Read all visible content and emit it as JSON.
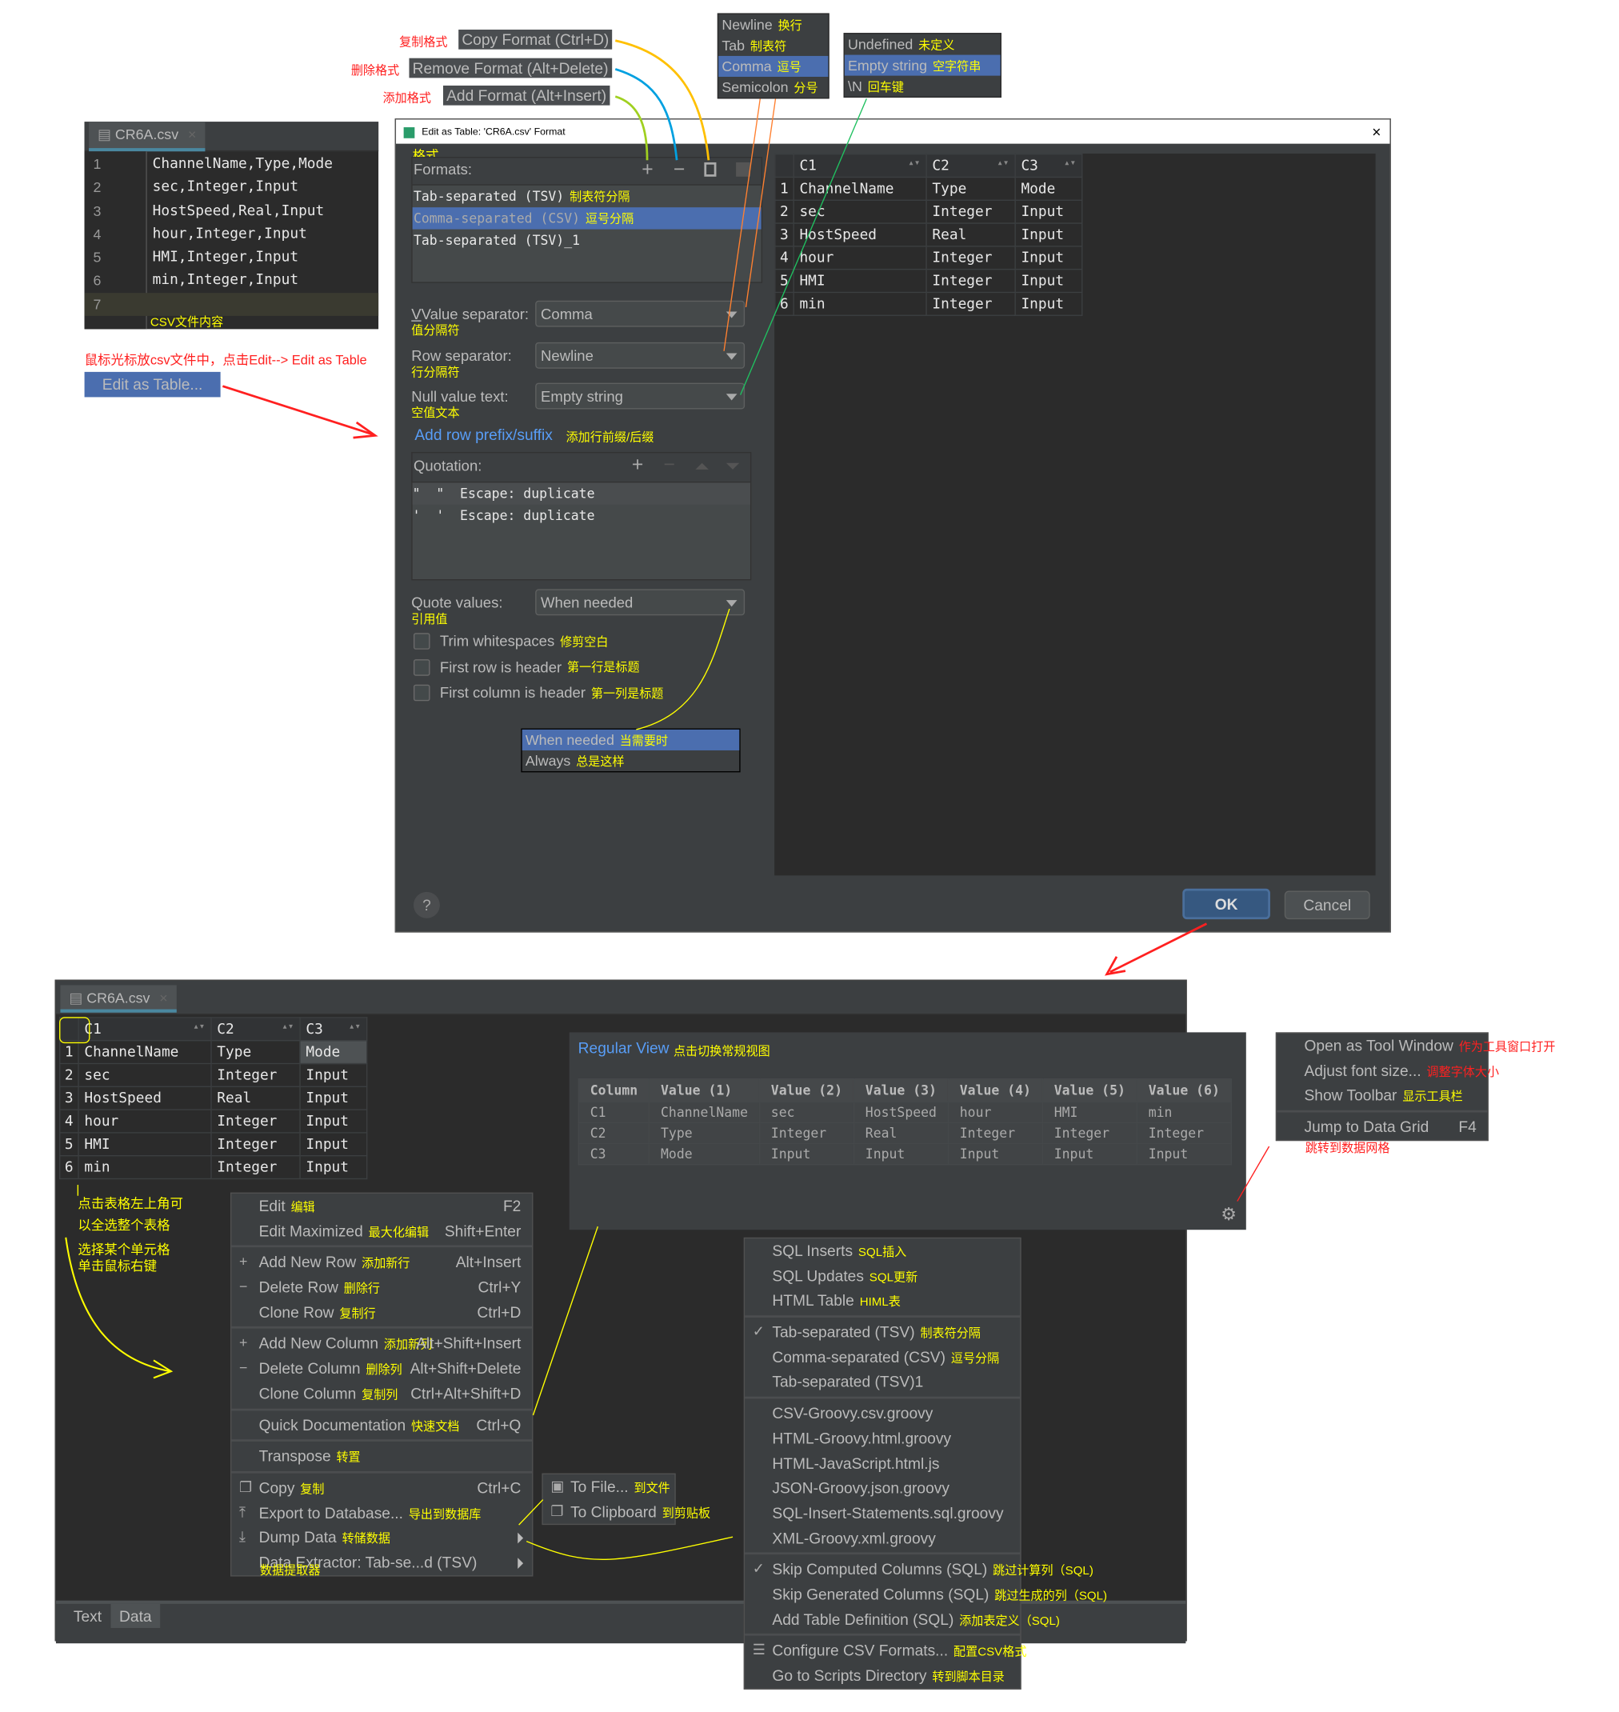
{
  "annotations": {
    "copy_format_cn": "复制格式",
    "remove_format_cn": "删除格式",
    "add_format_cn": "添加格式",
    "csv_content_cn": "CSV文件内容",
    "instruction_cn": "鼠标光标放csv文件中，点击Edit--> Edit as Table",
    "select_all_hint_1": "点击表格左上角可",
    "select_all_hint_2": "以全选整个表格",
    "right_click_hint_1": "选择某个单元格",
    "right_click_hint_2": "单击鼠标右键"
  },
  "tooltips": {
    "copy_format": "Copy Format (Ctrl+D)",
    "remove_format": "Remove Format (Alt+Delete)",
    "add_format": "Add Format (Alt+Insert)"
  },
  "row_separator_popup": [
    {
      "label": "Newline",
      "cn": "换行",
      "selected": false
    },
    {
      "label": "Tab",
      "cn": "制表符",
      "selected": false
    },
    {
      "label": "Comma",
      "cn": "逗号",
      "selected": true
    },
    {
      "label": "Semicolon",
      "cn": "分号",
      "selected": false
    }
  ],
  "null_value_popup": [
    {
      "label": "Undefined",
      "cn": "未定义",
      "selected": false
    },
    {
      "label": "Empty string",
      "cn": "空字符串",
      "selected": true
    },
    {
      "label": "\\N",
      "cn": "回车键",
      "selected": false
    }
  ],
  "editor_top": {
    "tab_label": "CR6A.csv",
    "lines": [
      {
        "n": "1",
        "text": "ChannelName,Type,Mode"
      },
      {
        "n": "2",
        "text": "sec,Integer,Input"
      },
      {
        "n": "3",
        "text": "HostSpeed,Real,Input"
      },
      {
        "n": "4",
        "text": "hour,Integer,Input"
      },
      {
        "n": "5",
        "text": "HMI,Integer,Input"
      },
      {
        "n": "6",
        "text": "min,Integer,Input"
      },
      {
        "n": "7",
        "text": ""
      }
    ]
  },
  "edit_as_table_menu_item": "Edit as Table...",
  "dialog": {
    "title": "Edit as Table: 'CR6A.csv' Format",
    "formats_cn": "格式",
    "formats_label": "Formats:",
    "formats": [
      {
        "label": "Tab-separated (TSV)",
        "cn": "制表符分隔",
        "selected": false
      },
      {
        "label": "Comma-separated (CSV)",
        "cn": "逗号分隔",
        "selected": true
      },
      {
        "label": "Tab-separated (TSV)_1",
        "cn": "",
        "selected": false
      }
    ],
    "value_separator_label": "Value separator:",
    "value_separator_cn": "值分隔符",
    "value_separator": "Comma",
    "row_separator_label": "Row separator:",
    "row_separator_cn": "行分隔符",
    "row_separator": "Newline",
    "null_value_label": "Null value text:",
    "null_value_cn": "空值文本",
    "null_value": "Empty string",
    "add_prefix_link": "Add row prefix/suffix",
    "add_prefix_cn": "添加行前缀/后缀",
    "quotation_label": "Quotation:",
    "quotations": [
      {
        "open": "\"",
        "close": "\"",
        "escape": "Escape: duplicate"
      },
      {
        "open": "'",
        "close": "'",
        "escape": "Escape: duplicate"
      }
    ],
    "quote_values_label": "Quote values:",
    "quote_values_cn": "引用值",
    "quote_values": "When needed",
    "checkboxes": [
      {
        "label": "Trim whitespaces",
        "cn": "修剪空白",
        "checked": false
      },
      {
        "label": "First row is header",
        "cn": "第一行是标题",
        "checked": false
      },
      {
        "label": "First column is header",
        "cn": "第一列是标题",
        "checked": false
      }
    ],
    "quote_popup": [
      {
        "label": "When needed",
        "cn": "当需要时",
        "selected": true
      },
      {
        "label": "Always",
        "cn": "总是这样",
        "selected": false
      }
    ],
    "preview": {
      "columns": [
        "C1",
        "C2",
        "C3"
      ],
      "rows": [
        [
          "1",
          "ChannelName",
          "Type",
          "Mode"
        ],
        [
          "2",
          "sec",
          "Integer",
          "Input"
        ],
        [
          "3",
          "HostSpeed",
          "Real",
          "Input"
        ],
        [
          "4",
          "hour",
          "Integer",
          "Input"
        ],
        [
          "5",
          "HMI",
          "Integer",
          "Input"
        ],
        [
          "6",
          "min",
          "Integer",
          "Input"
        ]
      ]
    },
    "help_label": "?",
    "ok_label": "OK",
    "cancel_label": "Cancel"
  },
  "editor_bottom": {
    "tab_label": "CR6A.csv",
    "columns": [
      "C1",
      "C2",
      "C3"
    ],
    "rows": [
      [
        "1",
        "ChannelName",
        "Type",
        "Mode"
      ],
      [
        "2",
        "sec",
        "Integer",
        "Input"
      ],
      [
        "3",
        "HostSpeed",
        "Real",
        "Input"
      ],
      [
        "4",
        "hour",
        "Integer",
        "Input"
      ],
      [
        "5",
        "HMI",
        "Integer",
        "Input"
      ],
      [
        "6",
        "min",
        "Integer",
        "Input"
      ]
    ],
    "bottom_tabs": [
      "Text",
      "Data"
    ]
  },
  "context_menu": {
    "groups": [
      [
        {
          "icon": "",
          "label": "Edit",
          "cn": "编辑",
          "shortcut": "F2"
        },
        {
          "icon": "",
          "label": "Edit Maximized",
          "cn": "最大化编辑",
          "shortcut": "Shift+Enter"
        }
      ],
      [
        {
          "icon": "plus",
          "label": "Add New Row",
          "cn": "添加新行",
          "shortcut": "Alt+Insert"
        },
        {
          "icon": "minus",
          "label": "Delete Row",
          "cn": "删除行",
          "shortcut": "Ctrl+Y"
        },
        {
          "icon": "",
          "label": "Clone Row",
          "cn": "复制行",
          "shortcut": "Ctrl+D"
        }
      ],
      [
        {
          "icon": "plus",
          "label": "Add New Column",
          "cn": "添加新列",
          "shortcut": "Alt+Shift+Insert"
        },
        {
          "icon": "minus",
          "label": "Delete Column",
          "cn": "删除列",
          "shortcut": "Alt+Shift+Delete"
        },
        {
          "icon": "",
          "label": "Clone Column",
          "cn": "复制列",
          "shortcut": "Ctrl+Alt+Shift+D"
        }
      ],
      [
        {
          "icon": "",
          "label": "Quick Documentation",
          "cn": "快速文档",
          "shortcut": "Ctrl+Q"
        }
      ],
      [
        {
          "icon": "",
          "label": "Transpose",
          "cn": "转置",
          "shortcut": ""
        }
      ],
      [
        {
          "icon": "copy",
          "label": "Copy",
          "cn": "复制",
          "shortcut": "Ctrl+C"
        },
        {
          "icon": "export",
          "label": "Export to Database...",
          "cn": "导出到数据库",
          "shortcut": ""
        },
        {
          "icon": "download",
          "label": "Dump Data",
          "cn": "转储数据",
          "shortcut": "",
          "submenu": true
        },
        {
          "icon": "",
          "label": "Data Extractor: Tab-se...d (TSV)",
          "cn": "",
          "shortcut": "",
          "submenu": true
        }
      ]
    ],
    "data_extractor_cn": "数据提取器"
  },
  "dump_submenu": [
    {
      "icon": "save",
      "label": "To File...",
      "cn": "到文件"
    },
    {
      "icon": "copy",
      "label": "To Clipboard",
      "cn": "到剪贴板"
    }
  ],
  "transposed_view": {
    "toggle_link": "Regular View",
    "toggle_cn": "点击切换常规视图",
    "headers": [
      "Column",
      "Value (1)",
      "Value (2)",
      "Value (3)",
      "Value (4)",
      "Value (5)",
      "Value (6)"
    ],
    "rows": [
      [
        "C1",
        "ChannelName",
        "sec",
        "HostSpeed",
        "hour",
        "HMI",
        "min"
      ],
      [
        "C2",
        "Type",
        "Integer",
        "Real",
        "Integer",
        "Integer",
        "Integer"
      ],
      [
        "C3",
        "Mode",
        "Input",
        "Input",
        "Input",
        "Input",
        "Input"
      ]
    ]
  },
  "settings_menu": [
    {
      "label": "Open as Tool Window",
      "cn": "作为工具窗口打开",
      "cn_color": "red",
      "shortcut": ""
    },
    {
      "label": "Adjust font size...",
      "cn": "调整字体大小",
      "cn_color": "red",
      "shortcut": ""
    },
    {
      "label": "Show Toolbar",
      "cn": "显示工具栏",
      "cn_color": "yellow",
      "shortcut": ""
    },
    {
      "label": "Jump to Data Grid",
      "cn": "",
      "cn_color": "",
      "shortcut": "F4"
    }
  ],
  "settings_jump_cn": "跳转到数据网格",
  "extractor_menu": {
    "groups": [
      [
        {
          "check": false,
          "label": "SQL Inserts",
          "cn": "SQL插入"
        },
        {
          "check": false,
          "label": "SQL Updates",
          "cn": "SQL更新"
        },
        {
          "check": false,
          "label": "HTML Table",
          "cn": "HIML表"
        }
      ],
      [
        {
          "check": true,
          "label": "Tab-separated (TSV)",
          "cn": "制表符分隔"
        },
        {
          "check": false,
          "label": "Comma-separated (CSV)",
          "cn": "逗号分隔"
        },
        {
          "check": false,
          "label": "Tab-separated (TSV)1",
          "cn": ""
        }
      ],
      [
        {
          "check": false,
          "label": "CSV-Groovy.csv.groovy",
          "cn": ""
        },
        {
          "check": false,
          "label": "HTML-Groovy.html.groovy",
          "cn": ""
        },
        {
          "check": false,
          "label": "HTML-JavaScript.html.js",
          "cn": ""
        },
        {
          "check": false,
          "label": "JSON-Groovy.json.groovy",
          "cn": ""
        },
        {
          "check": false,
          "label": "SQL-Insert-Statements.sql.groovy",
          "cn": ""
        },
        {
          "check": false,
          "label": "XML-Groovy.xml.groovy",
          "cn": ""
        }
      ],
      [
        {
          "check": true,
          "label": "Skip Computed Columns (SQL)",
          "cn": "跳过计算列（SQL)"
        },
        {
          "check": false,
          "label": "Skip Generated Columns (SQL)",
          "cn": "跳过生成的列（SQL)"
        },
        {
          "check": false,
          "label": "Add Table Definition (SQL)",
          "cn": "添加表定义（SQL)"
        }
      ],
      [
        {
          "check": false,
          "icon": "sliders",
          "label": "Configure CSV Formats...",
          "cn": "配置CSV格式"
        },
        {
          "check": false,
          "label": "Go to Scripts Directory",
          "cn": "转到脚本目录"
        }
      ]
    ]
  },
  "colors": {
    "selection": "#4b6eaf",
    "panel": "#3c3f41",
    "editor_bg": "#2b2b2b",
    "link": "#589df6",
    "annotation_yellow": "#ffff00",
    "annotation_red": "#ff2020"
  }
}
